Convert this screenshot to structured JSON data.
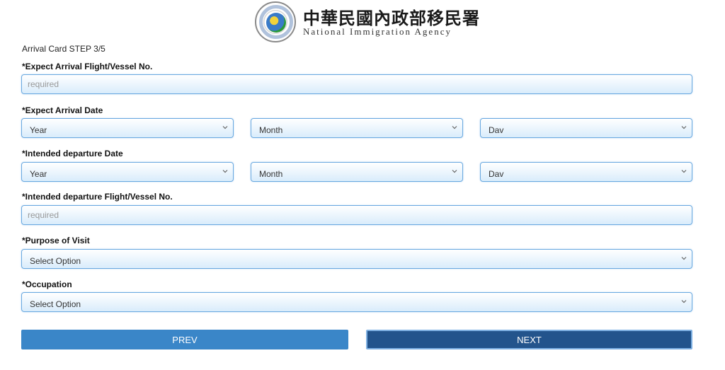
{
  "header": {
    "agency_cn": "中華民國內政部移民署",
    "agency_en": "National Immigration Agency",
    "seal": "agency-seal-icon"
  },
  "step_text": "Arrival Card STEP 3/5",
  "fields": {
    "arrival_flight": {
      "label": "*Expect Arrival Flight/Vessel No.",
      "placeholder": "required",
      "value": ""
    },
    "arrival_date": {
      "label": "*Expect Arrival Date",
      "year": "Year",
      "month": "Month",
      "day": "Dav"
    },
    "departure_date": {
      "label": "*Intended departure Date",
      "year": "Year",
      "month": "Month",
      "day": "Dav"
    },
    "departure_flight": {
      "label": "*Intended departure Flight/Vessel No.",
      "placeholder": "required",
      "value": ""
    },
    "purpose": {
      "label": "*Purpose of Visit",
      "selected": "Select Option"
    },
    "occupation": {
      "label": "*Occupation",
      "selected": "Select Option"
    }
  },
  "buttons": {
    "prev": "PREV",
    "next": "NEXT"
  },
  "colors": {
    "accent": "#3a86c8",
    "primary_dark": "#23548c",
    "field_border": "#6aa9e0"
  }
}
